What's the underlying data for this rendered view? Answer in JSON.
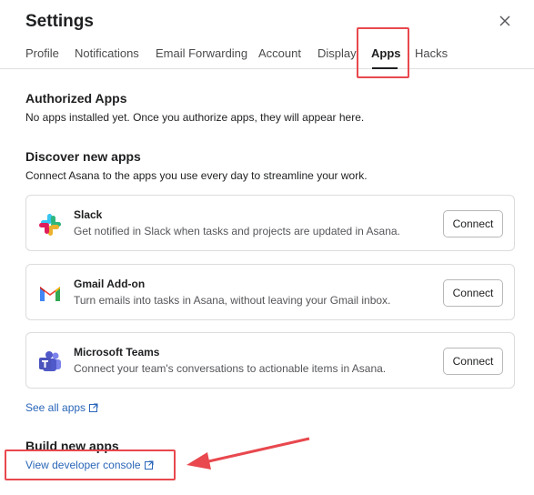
{
  "dialog": {
    "title": "Settings",
    "close_icon": "close-icon"
  },
  "tabs": [
    {
      "label": "Profile"
    },
    {
      "label": "Notifications"
    },
    {
      "label": "Email Forwarding"
    },
    {
      "label": "Account"
    },
    {
      "label": "Display"
    },
    {
      "label": "Apps",
      "active": true
    },
    {
      "label": "Hacks"
    }
  ],
  "authorized": {
    "title": "Authorized Apps",
    "description": "No apps installed yet. Once you authorize apps, they will appear here."
  },
  "discover": {
    "title": "Discover new apps",
    "description": "Connect Asana to the apps you use every day to streamline your work.",
    "apps": [
      {
        "name": "Slack",
        "description": "Get notified in Slack when tasks and projects are updated in Asana.",
        "button": "Connect",
        "icon": "slack-logo"
      },
      {
        "name": "Gmail Add-on",
        "description": "Turn emails into tasks in Asana, without leaving your Gmail inbox.",
        "button": "Connect",
        "icon": "gmail-logo"
      },
      {
        "name": "Microsoft Teams",
        "description": "Connect your team's conversations to actionable items in Asana.",
        "button": "Connect",
        "icon": "teams-logo"
      }
    ],
    "see_all": "See all apps"
  },
  "build": {
    "title": "Build new apps",
    "console_link": "View developer console"
  },
  "colors": {
    "link": "#2a66b8",
    "highlight": "#e8484e"
  }
}
